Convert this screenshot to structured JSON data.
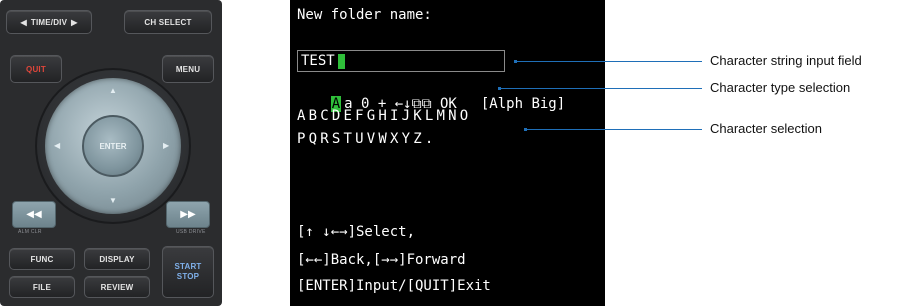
{
  "panel": {
    "time_div": "TIME/DIV",
    "ch_select": "CH SELECT",
    "quit": "QUIT",
    "menu": "MENU",
    "enter": "ENTER",
    "rewind_icon": "rewind-icon",
    "forward_icon": "fast-forward-icon",
    "alm_clr": "ALM CLR",
    "usb_drive": "USB DRIVE",
    "func": "FUNC",
    "display": "DISPLAY",
    "file": "FILE",
    "review": "REVIEW",
    "start": "START",
    "stop": "STOP",
    "colors": {
      "quit_text": "#e0463a",
      "start_stop_text": "#7fb0ea",
      "dial": "#8fa3ab"
    }
  },
  "screen": {
    "title": "New folder name:",
    "input_value": "TEST",
    "type_row": {
      "selected": "A",
      "rest": "a 0 + ←↓⧉⧉ OK",
      "mode": "[Alph Big]"
    },
    "chars_row1": "ABCDEFGHIJKLMNO",
    "chars_row2": "PQRSTUVWXYZ.",
    "help1": "[↑ ↓←→]Select,",
    "help2": "[←←]Back,[→→]Forward",
    "help3": "[ENTER]Input/[QUIT]Exit",
    "colors": {
      "background": "#000000",
      "highlight": "#2fbf3a",
      "text": "#ffffff"
    }
  },
  "callouts": [
    {
      "label": "Character string input field"
    },
    {
      "label": "Character type selection"
    },
    {
      "label": "Character selection"
    }
  ],
  "callout_color": "#1f6fb8"
}
